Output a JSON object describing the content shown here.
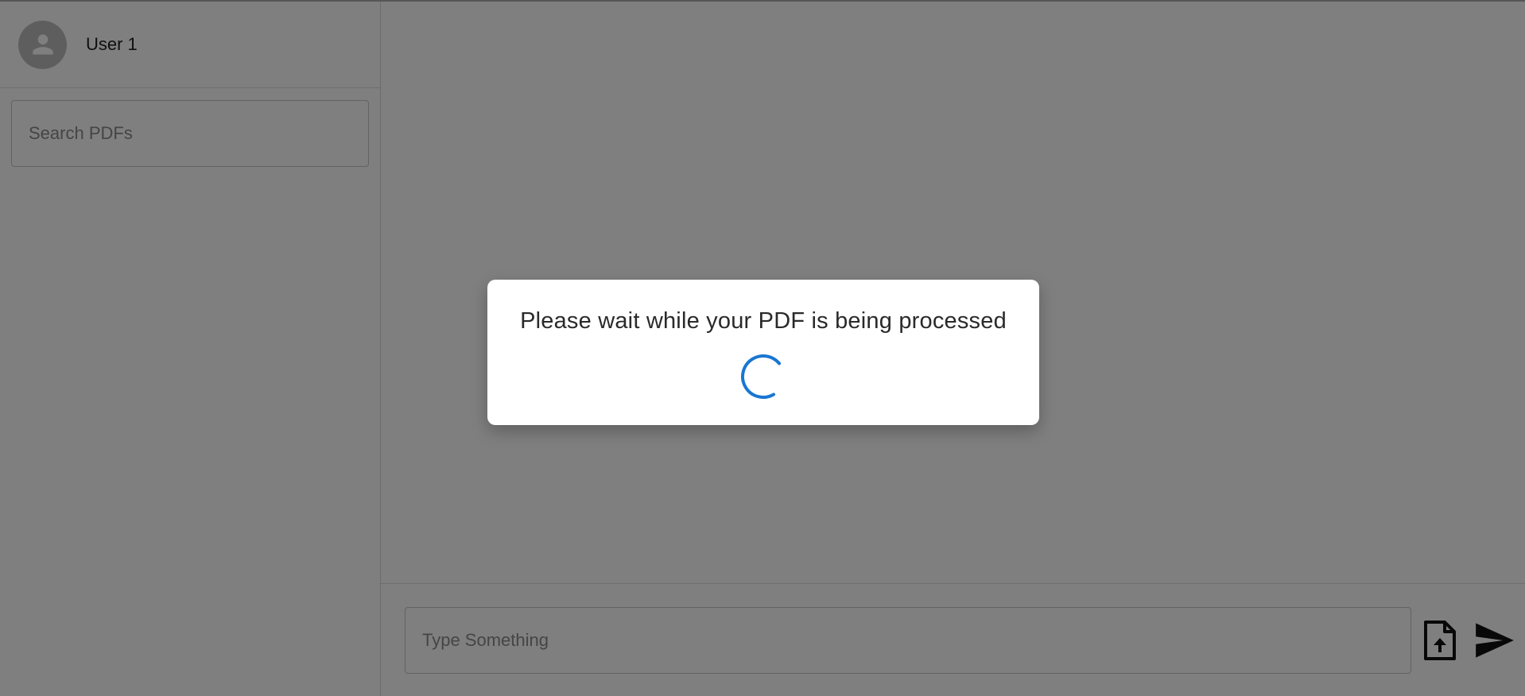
{
  "sidebar": {
    "user": {
      "avatar_icon": "person-icon",
      "name": "User 1"
    },
    "search": {
      "placeholder": "Search PDFs",
      "value": ""
    }
  },
  "composer": {
    "input": {
      "placeholder": "Type Something",
      "value": ""
    },
    "upload_icon": "file-upload-icon",
    "send_icon": "send-icon"
  },
  "dialog": {
    "message": "Please wait while your PDF is being processed",
    "spinner_color": "#1976d2"
  },
  "colors": {
    "overlay": "rgba(0,0,0,0.5)",
    "accent": "#1976d2"
  }
}
